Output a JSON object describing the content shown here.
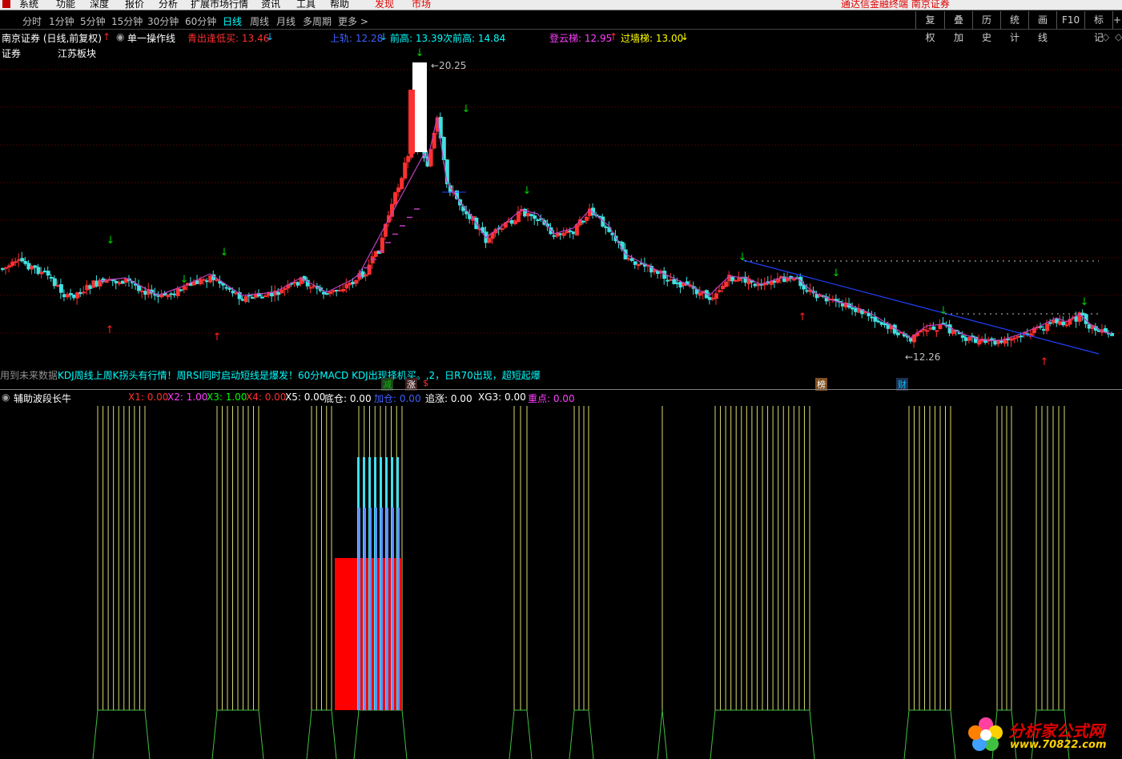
{
  "menu": {
    "items": [
      "系统",
      "功能",
      "深度",
      "报价",
      "分析",
      "扩展市场行情",
      "资讯",
      "工具",
      "帮助"
    ],
    "discover": "发现",
    "market": "市场",
    "right_text": "通达信金融终端 南京证券"
  },
  "periods": {
    "items": [
      "分时",
      "1分钟",
      "5分钟",
      "15分钟",
      "30分钟",
      "60分钟",
      "日线",
      "周线",
      "月线",
      "多周期",
      "更多 >"
    ],
    "active": "日线"
  },
  "toolbar": {
    "buttons": [
      "复权",
      "叠加",
      "历史",
      "统计",
      "画线",
      "F10",
      "标记",
      "+自"
    ]
  },
  "main_info": {
    "stock": "南京证券 (日线,前复权)",
    "indicator": "单一操作线",
    "sell_label": "青出逢低买: 13.46",
    "upper_label": "上轨: 12.28",
    "prev_high_label": "前高: 13.39",
    "next_prev_high_label": "次前高: 14.84",
    "ladder_label": "登云梯: 12.95",
    "wall_label": "过墙梯: 13.00",
    "options_icon": "◇"
  },
  "sector": {
    "label1": "证券",
    "label2": "江苏板块"
  },
  "chart_annotations": {
    "high_label": "20.25",
    "low_label": "12.26"
  },
  "scroll_text": {
    "gray": "用到未来数据",
    "cyan": "KDJ周线上周K拐头有行情！周RSI同时启动短线是爆发！60分MACD KDJ出现择机买。,2，日R70出现，超短起爆"
  },
  "event_tags": [
    {
      "text": "减",
      "color": "#00c000"
    },
    {
      "text": "涨",
      "color": "#ffffff"
    },
    {
      "text": "$",
      "color": "#ff3030"
    },
    {
      "text": "榜",
      "color": "#ffffff"
    },
    {
      "text": "财",
      "color": "#00c0ff"
    }
  ],
  "sub_info": {
    "indicator": "辅助波段长牛",
    "values": [
      {
        "label": "X1: 0.00",
        "color": "#ff3030"
      },
      {
        "label": "X2: 1.00",
        "color": "#ff40ff"
      },
      {
        "label": "X3: 1.00",
        "color": "#00ff00"
      },
      {
        "label": "X4: 0.00",
        "color": "#ff3030"
      },
      {
        "label": "X5: 0.00",
        "color": "#ffffff"
      },
      {
        "label": "底仓: 0.00",
        "color": "#ffffff"
      },
      {
        "label": "加仓: 0.00",
        "color": "#4060ff"
      },
      {
        "label": "追涨: 0.00",
        "color": "#ffffff"
      },
      {
        "label": "XG3: 0.00",
        "color": "#ffffff"
      },
      {
        "label": "重点: 0.00",
        "color": "#ff40ff"
      }
    ]
  },
  "watermark": {
    "title": "分析家公式网",
    "url": "www.70822.com"
  },
  "colors": {
    "up": "#ff3030",
    "down": "#40e0e0",
    "arrow_up": "#ff2020",
    "arrow_down": "#00d000",
    "ma": "#c040c0",
    "trend": "#2040ff",
    "sub_lines": "#d8d870",
    "sub_cyan": "#40e0f0",
    "sub_blue": "#6090ff",
    "sub_red": "#ff0000"
  }
}
